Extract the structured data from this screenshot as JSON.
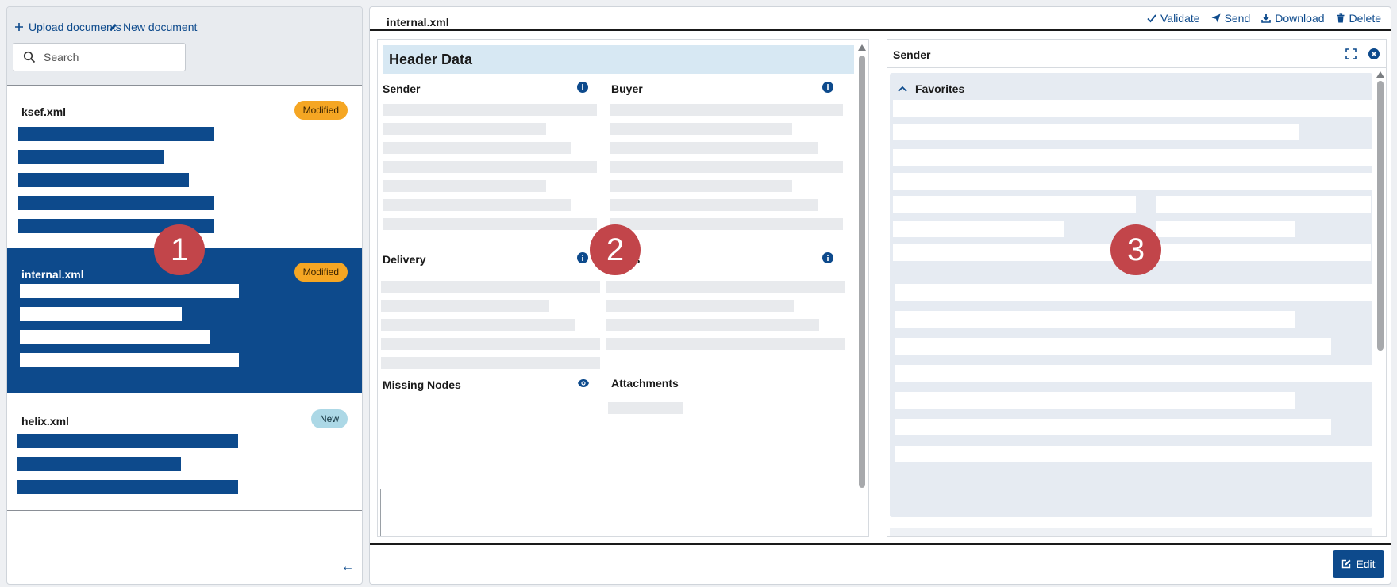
{
  "left_panel": {
    "upload_label": "Upload documents",
    "new_label": "New document",
    "search_placeholder": "Search",
    "documents": [
      {
        "name": "ksef.xml",
        "badge": "Modified"
      },
      {
        "name": "internal.xml",
        "badge": "Modified"
      },
      {
        "name": "helix.xml",
        "badge": "New"
      }
    ],
    "collapse_glyph": "←"
  },
  "main": {
    "title": "internal.xml",
    "toolbar": {
      "validate": "Validate",
      "send": "Send",
      "download": "Download",
      "delete": "Delete"
    },
    "edit_label": "Edit"
  },
  "header_data": {
    "title": "Header Data",
    "sections": {
      "sender": "Sender",
      "buyer": "Buyer",
      "delivery": "Delivery",
      "obscured": "ts",
      "missing_nodes": "Missing Nodes",
      "attachments": "Attachments"
    }
  },
  "sender_panel": {
    "title": "Sender",
    "favorites": "Favorites"
  },
  "markers": [
    "1",
    "2",
    "3"
  ],
  "colors": {
    "primary": "#0d4a8c",
    "badge_modified": "#f5a623",
    "badge_new": "#acd8e6",
    "marker": "#c2454a",
    "header_bg": "#d7e8f3",
    "favorites_bg": "#e6ebf2"
  }
}
